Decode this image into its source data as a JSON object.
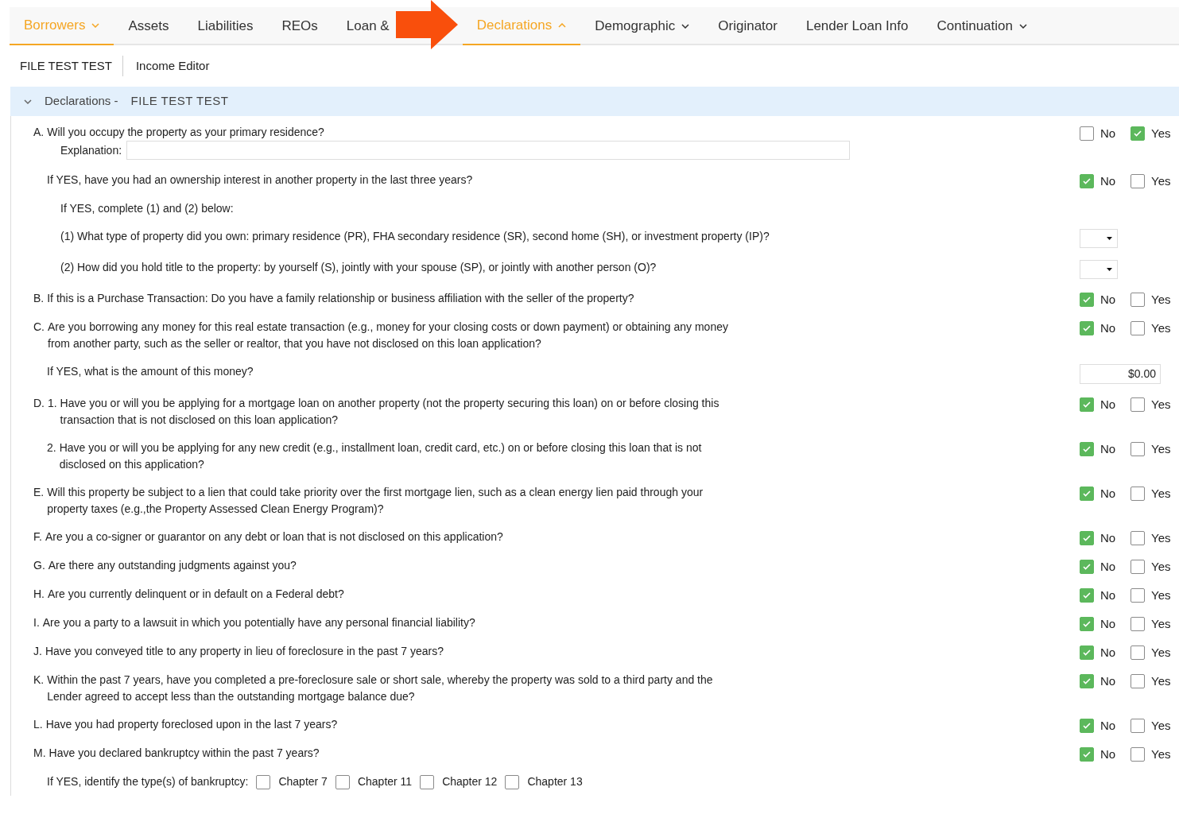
{
  "tabs": [
    {
      "label": "Borrowers",
      "selected": true,
      "has_menu": true,
      "expanded": false
    },
    {
      "label": "Assets",
      "selected": false
    },
    {
      "label": "Liabilities",
      "selected": false
    },
    {
      "label": "REOs",
      "selected": false
    },
    {
      "label": "Loan &",
      "selected": false
    },
    {
      "label": "Declarations",
      "selected": true,
      "has_menu": true,
      "expanded": true
    },
    {
      "label": "Demographic",
      "selected": false,
      "has_menu": true,
      "expanded": false
    },
    {
      "label": "Originator",
      "selected": false
    },
    {
      "label": "Lender Loan Info",
      "selected": false
    },
    {
      "label": "Continuation",
      "selected": false,
      "has_menu": true,
      "expanded": false
    }
  ],
  "subnav": [
    "FILE TEST TEST",
    "Income Editor"
  ],
  "section": {
    "expanded": true,
    "title": "Declarations -",
    "borrower": "FILE TEST TEST"
  },
  "questions": [
    {
      "kind": "yesno",
      "marker": "A.",
      "text": "Will you occupy the property as your primary residence?",
      "options": [
        {
          "label": "No",
          "checked": false
        },
        {
          "label": "Yes",
          "checked": true
        }
      ],
      "explanation": {
        "label": "Explanation:"
      },
      "children": [
        {
          "kind": "yesno",
          "text": "If YES, have you had an ownership interest in another property in the last three years?",
          "options": [
            {
              "label": "No",
              "checked": true
            },
            {
              "label": "Yes",
              "checked": false
            }
          ],
          "children": [
            {
              "kind": "note",
              "text": "If YES, complete (1) and (2) below:"
            },
            {
              "kind": "select",
              "text": "(1) What type of property did you own: primary residence (PR), FHA secondary residence (SR), second home (SH), or investment property (IP)?"
            },
            {
              "kind": "select",
              "text": "(2) How did you hold title to the property: by yourself (S), jointly with your spouse (SP), or jointly with another person (O)?"
            }
          ]
        }
      ]
    },
    {
      "kind": "yesno",
      "marker": "B.",
      "text": "If this is a Purchase Transaction: Do you have a family relationship or business affiliation with the seller of the property?",
      "options": [
        {
          "label": "No",
          "checked": true
        },
        {
          "label": "Yes",
          "checked": false
        }
      ]
    },
    {
      "kind": "yesno",
      "marker": "C.",
      "text": "Are you borrowing any money for this real estate transaction (e.g., money for your closing costs or down payment) or obtaining any money from another party, such as the seller or realtor, that you have not disclosed on this loan application?",
      "options": [
        {
          "label": "No",
          "checked": true
        },
        {
          "label": "Yes",
          "checked": false
        }
      ],
      "children": [
        {
          "kind": "amount",
          "text": "If YES, what is the amount of this money?",
          "value": "$0.00"
        }
      ]
    },
    {
      "kind": "yesno",
      "marker": "D. 1.",
      "text": "Have you or will you be applying for a mortgage loan on another property (not the property securing this loan) on or before closing this transaction that is not disclosed on this loan application?",
      "options": [
        {
          "label": "No",
          "checked": true
        },
        {
          "label": "Yes",
          "checked": false
        }
      ]
    },
    {
      "kind": "subitem",
      "marker": "2.",
      "text": "Have you or will you be applying for any new credit (e.g., installment loan, credit card, etc.) on or before closing this loan that is not disclosed on this application?",
      "options": [
        {
          "label": "No",
          "checked": true
        },
        {
          "label": "Yes",
          "checked": false
        }
      ]
    },
    {
      "kind": "yesno",
      "marker": "E.",
      "text": "Will this property be subject to a lien that could take priority over the first mortgage lien, such as a clean energy lien paid through your property taxes (e.g.,the Property Assessed Clean Energy Program)?",
      "options": [
        {
          "label": "No",
          "checked": true
        },
        {
          "label": "Yes",
          "checked": false
        }
      ]
    },
    {
      "kind": "yesno",
      "marker": "F.",
      "text": "Are you a co-signer or guarantor on any debt or loan that is not disclosed on this application?",
      "options": [
        {
          "label": "No",
          "checked": true
        },
        {
          "label": "Yes",
          "checked": false
        }
      ]
    },
    {
      "kind": "yesno",
      "marker": "G.",
      "text": "Are there any outstanding judgments against you?",
      "options": [
        {
          "label": "No",
          "checked": true
        },
        {
          "label": "Yes",
          "checked": false
        }
      ]
    },
    {
      "kind": "yesno",
      "marker": "H.",
      "text": "Are you currently delinquent or in default on a Federal debt?",
      "options": [
        {
          "label": "No",
          "checked": true
        },
        {
          "label": "Yes",
          "checked": false
        }
      ]
    },
    {
      "kind": "yesno",
      "marker": "I.",
      "text": "Are you a party to a lawsuit in which you potentially have any personal financial liability?",
      "options": [
        {
          "label": "No",
          "checked": true
        },
        {
          "label": "Yes",
          "checked": false
        }
      ]
    },
    {
      "kind": "yesno",
      "marker": "J.",
      "text": "Have you conveyed title to any property in lieu of foreclosure in the past 7 years?",
      "options": [
        {
          "label": "No",
          "checked": true
        },
        {
          "label": "Yes",
          "checked": false
        }
      ]
    },
    {
      "kind": "yesno",
      "marker": "K.",
      "text": "Within the past 7 years, have you completed a pre-foreclosure sale or short sale, whereby the property was sold to a third party and the Lender agreed to accept less than the outstanding mortgage balance due?",
      "options": [
        {
          "label": "No",
          "checked": true
        },
        {
          "label": "Yes",
          "checked": false
        }
      ]
    },
    {
      "kind": "yesno",
      "marker": "L.",
      "text": "Have you had property foreclosed upon in the last 7 years?",
      "options": [
        {
          "label": "No",
          "checked": true
        },
        {
          "label": "Yes",
          "checked": false
        }
      ]
    },
    {
      "kind": "yesno",
      "marker": "M.",
      "text": "Have you declared bankruptcy within the past 7 years?",
      "options": [
        {
          "label": "No",
          "checked": true
        },
        {
          "label": "Yes",
          "checked": false
        }
      ],
      "children": [
        {
          "kind": "bankruptcy",
          "text": "If YES, identify the type(s) of bankruptcy:",
          "options": [
            {
              "label": "Chapter 7",
              "checked": false
            },
            {
              "label": "Chapter 11",
              "checked": false
            },
            {
              "label": "Chapter 12",
              "checked": false
            },
            {
              "label": "Chapter 13",
              "checked": false
            }
          ]
        }
      ]
    }
  ]
}
